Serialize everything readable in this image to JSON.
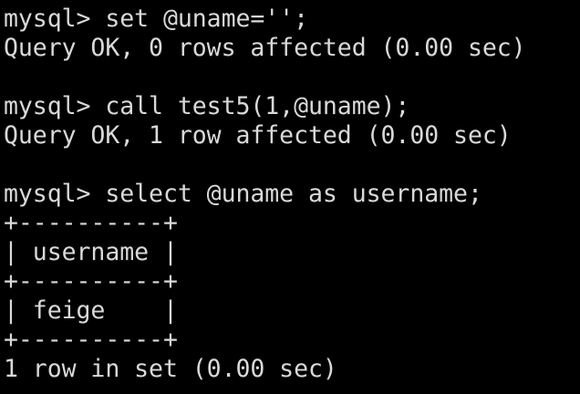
{
  "terminal": {
    "lines": [
      "mysql> set @uname='';",
      "Query OK, 0 rows affected (0.00 sec)",
      "",
      "mysql> call test5(1,@uname);",
      "Query OK, 1 row affected (0.00 sec)",
      "",
      "mysql> select @uname as username;",
      "+----------+",
      "| username |",
      "+----------+",
      "| feige    |",
      "+----------+",
      "1 row in set (0.00 sec)"
    ]
  },
  "colors": {
    "background": "#000000",
    "text": "#d9d9d9"
  }
}
